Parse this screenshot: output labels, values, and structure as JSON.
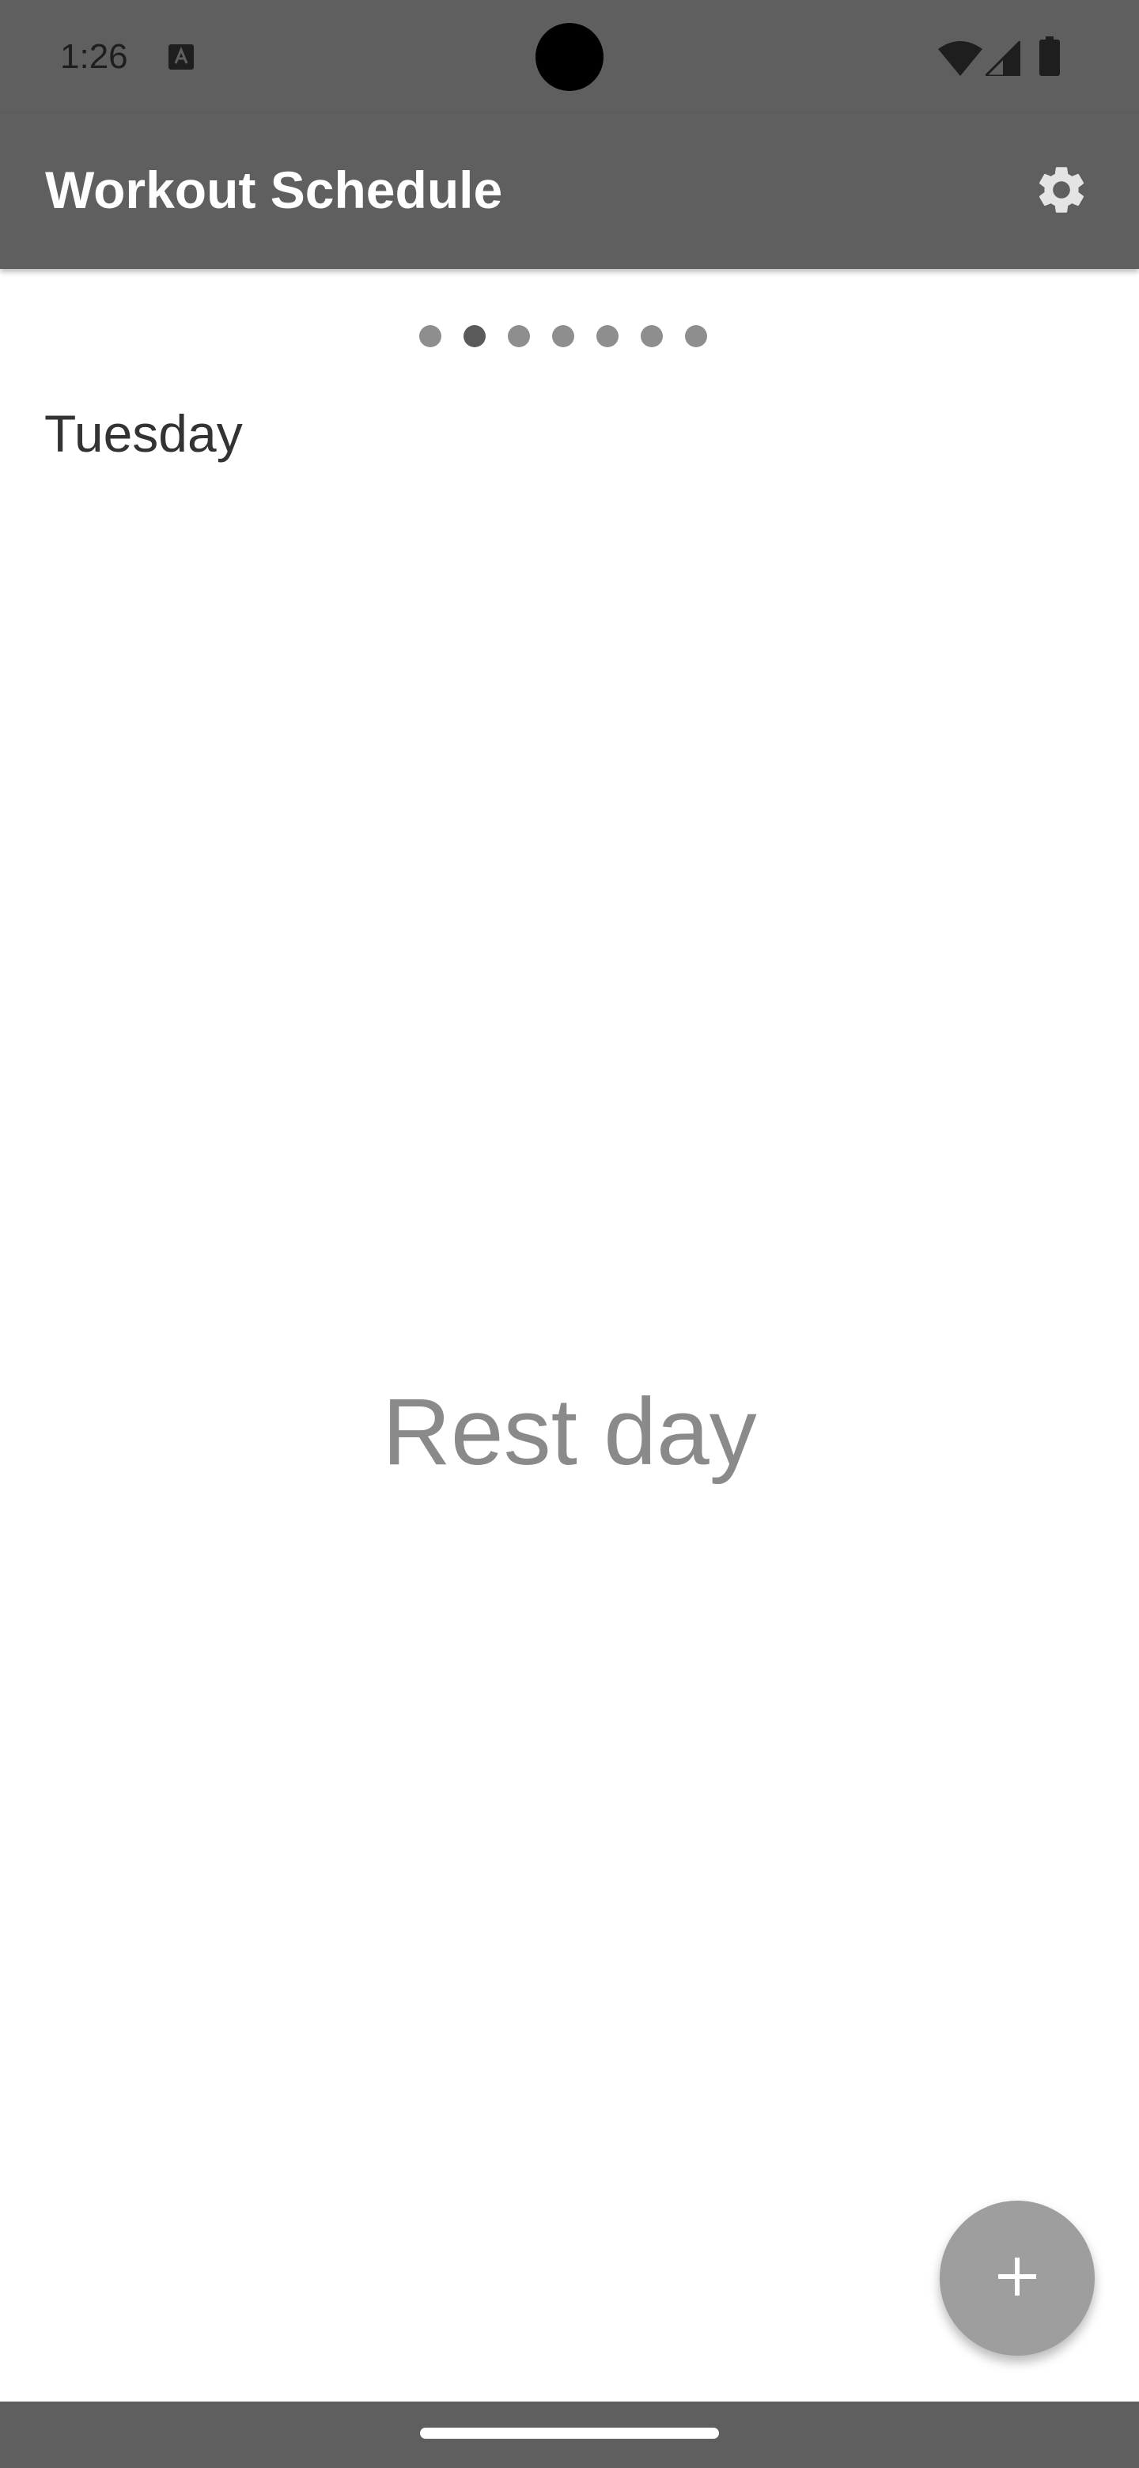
{
  "status_bar": {
    "time": "1:26",
    "notification_icon": "text-a-icon",
    "wifi_icon": "wifi-icon",
    "signal_icon": "cell-signal-icon",
    "battery_icon": "battery-icon"
  },
  "app_bar": {
    "title": "Workout Schedule",
    "settings_icon": "gear-icon"
  },
  "pager": {
    "page_count": 7,
    "current_page": 2
  },
  "day": {
    "name": "Tuesday",
    "empty_message": "Rest day"
  },
  "fab": {
    "icon": "plus-icon"
  },
  "colors": {
    "app_bar": "#5f5f5f",
    "background": "#ffffff",
    "fab": "#9e9e9e",
    "dot_inactive": "#8e8e8e",
    "dot_active": "#5a5a5a",
    "rest_text": "#8a8a8a"
  }
}
